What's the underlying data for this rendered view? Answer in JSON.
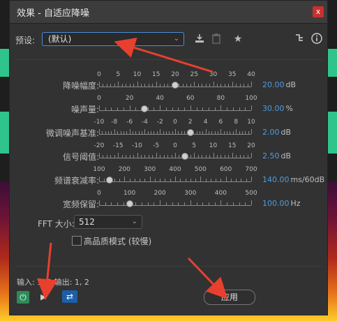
{
  "title": "效果 - 自适应降噪",
  "close_label": "x",
  "preset": {
    "label": "预设:",
    "value": "(默认)"
  },
  "params": [
    {
      "label": "降噪幅度:",
      "ticks": [
        "0",
        "5",
        "10",
        "15",
        "20",
        "25",
        "30",
        "35",
        "40"
      ],
      "value": "20.00",
      "unit": "dB",
      "fraction": 0.5
    },
    {
      "label": "噪声量:",
      "ticks": [
        "0",
        "20",
        "40",
        "60",
        "80",
        "100"
      ],
      "value": "30.00",
      "unit": "%",
      "fraction": 0.3
    },
    {
      "label": "微调噪声基准:",
      "ticks": [
        "-10",
        "-8",
        "-6",
        "-4",
        "-2",
        "0",
        "2",
        "4",
        "6",
        "8",
        "10"
      ],
      "value": "2.00",
      "unit": "dB",
      "fraction": 0.6
    },
    {
      "label": "信号阈值:",
      "ticks": [
        "-20",
        "-15",
        "-10",
        "-5",
        "0",
        "5",
        "10",
        "15",
        "20"
      ],
      "value": "2.50",
      "unit": "dB",
      "fraction": 0.5625
    },
    {
      "label": "频谱衰减率:",
      "ticks": [
        "100",
        "200",
        "300",
        "400",
        "500",
        "600",
        "700"
      ],
      "value": "140.00",
      "unit": "ms/60dB",
      "fraction": 0.0667
    },
    {
      "label": "宽频保留:",
      "ticks": [
        "0",
        "100",
        "200",
        "300",
        "400",
        "500"
      ],
      "value": "100.00",
      "unit": "Hz",
      "fraction": 0.2
    }
  ],
  "fft": {
    "label": "FFT 大小:",
    "value": "512"
  },
  "high_quality_label": "高品质模式 (较慢)",
  "io_text": "输入: 1, 2   输出: 1, 2",
  "apply_label": "应用",
  "colors": {
    "accent_value": "#4e9be0",
    "annotation_arrow": "#e8402f",
    "power": "#2e8b57",
    "loop": "#1c5ea8",
    "close": "#c8312e"
  },
  "icons": {
    "save_preset": "download-icon",
    "delete_preset": "trash-icon",
    "favorite": "star-icon",
    "routing": "routing-icon",
    "info": "info-icon",
    "power": "power-icon",
    "play": "play-icon",
    "loop": "loop-icon"
  }
}
